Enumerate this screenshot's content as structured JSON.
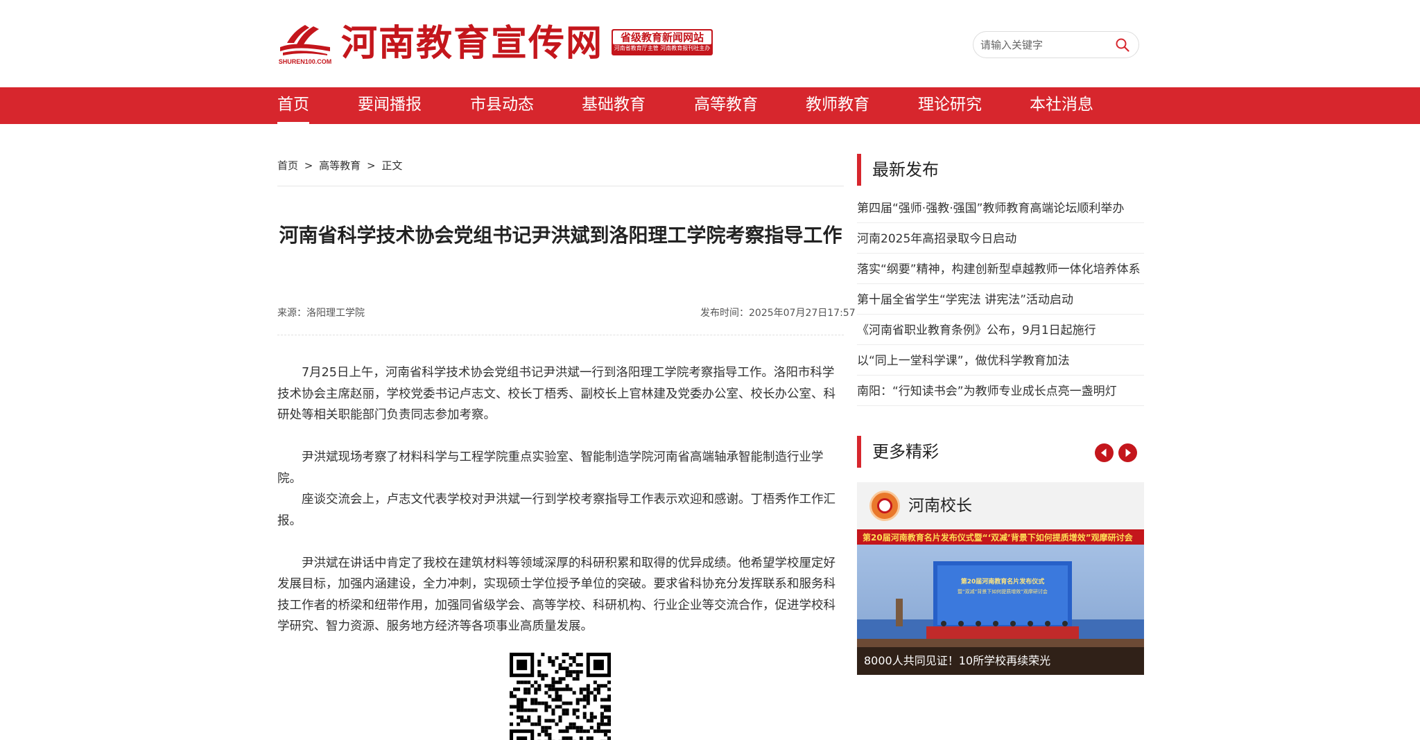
{
  "header": {
    "site_title": "河南教育宣传网",
    "logo_sub": "SHUREN100.COM",
    "badge_main": "省级教育新闻网站",
    "badge_sub": "河南省教育厅主管 河南教育报刊社主办",
    "search_placeholder": "请输入关键字"
  },
  "nav": {
    "items": [
      {
        "label": "首页",
        "active": true
      },
      {
        "label": "要闻播报"
      },
      {
        "label": "市县动态"
      },
      {
        "label": "基础教育"
      },
      {
        "label": "高等教育"
      },
      {
        "label": "教师教育"
      },
      {
        "label": "理论研究"
      },
      {
        "label": "本社消息"
      }
    ]
  },
  "breadcrumb": {
    "home": "首页",
    "sep1": ">",
    "category": "高等教育",
    "sep2": ">",
    "current": "正文"
  },
  "article": {
    "title": "河南省科学技术协会党组书记尹洪斌到洛阳理工学院考察指导工作",
    "source": "来源：洛阳理工学院",
    "published": "发布时间：2025年07月27日17:57",
    "paragraphs": [
      "7月25日上午，河南省科学技术协会党组书记尹洪斌一行到洛阳理工学院考察指导工作。洛阳市科学技术协会主席赵丽，学校党委书记卢志文、校长丁梧秀、副校长上官林建及党委办公室、校长办公室、科研处等相关职能部门负责同志参加考察。",
      "尹洪斌现场考察了材料科学与工程学院重点实验室、智能制造学院河南省高端轴承智能制造行业学院。",
      "座谈交流会上，卢志文代表学校对尹洪斌一行到学校考察指导工作表示欢迎和感谢。丁梧秀作工作汇报。",
      "尹洪斌在讲话中肯定了我校在建筑材料等领域深厚的科研积累和取得的优异成绩。他希望学校厘定好发展目标，加强内涵建设，全力冲刺，实现硕士学位授予单位的突破。要求省科协充分发挥联系和服务科技工作者的桥梁和纽带作用，加强同省级学会、高等学校、科研机构、行业企业等交流合作，促进学校科学研究、智力资源、服务地方经济等各项事业高质量发展。"
    ]
  },
  "sidebar": {
    "latest_title": "最新发布",
    "latest_items": [
      "第四届“强师·强教·强国”教师教育高端论坛顺利举办",
      "河南2025年高招录取今日启动",
      "落实“纲要”精神，构建创新型卓越教师一体化培养体系",
      "第十届全省学生“学宪法 讲宪法”活动启动",
      "《河南省职业教育条例》公布，9月1日起施行",
      "以“同上一堂科学课”，做优科学教育加法",
      "南阳：“行知读书会”为教师专业成长点亮一盏明灯"
    ],
    "more_title": "更多精彩",
    "card": {
      "channel": "河南校长",
      "banner_text": "第20届河南教育名片发布仪式暨“‘双减’背景下如何提质增效”观摩研讨会",
      "stage_line1": "第20届河南教育名片发布仪式",
      "stage_line2": "暨“双减”背景下如何提质增效”观摩研讨会",
      "caption": "8000人共同见证！10所学校再续荣光"
    }
  },
  "colors": {
    "brand_red": "#d7262d",
    "logo_red": "#c4161c"
  }
}
